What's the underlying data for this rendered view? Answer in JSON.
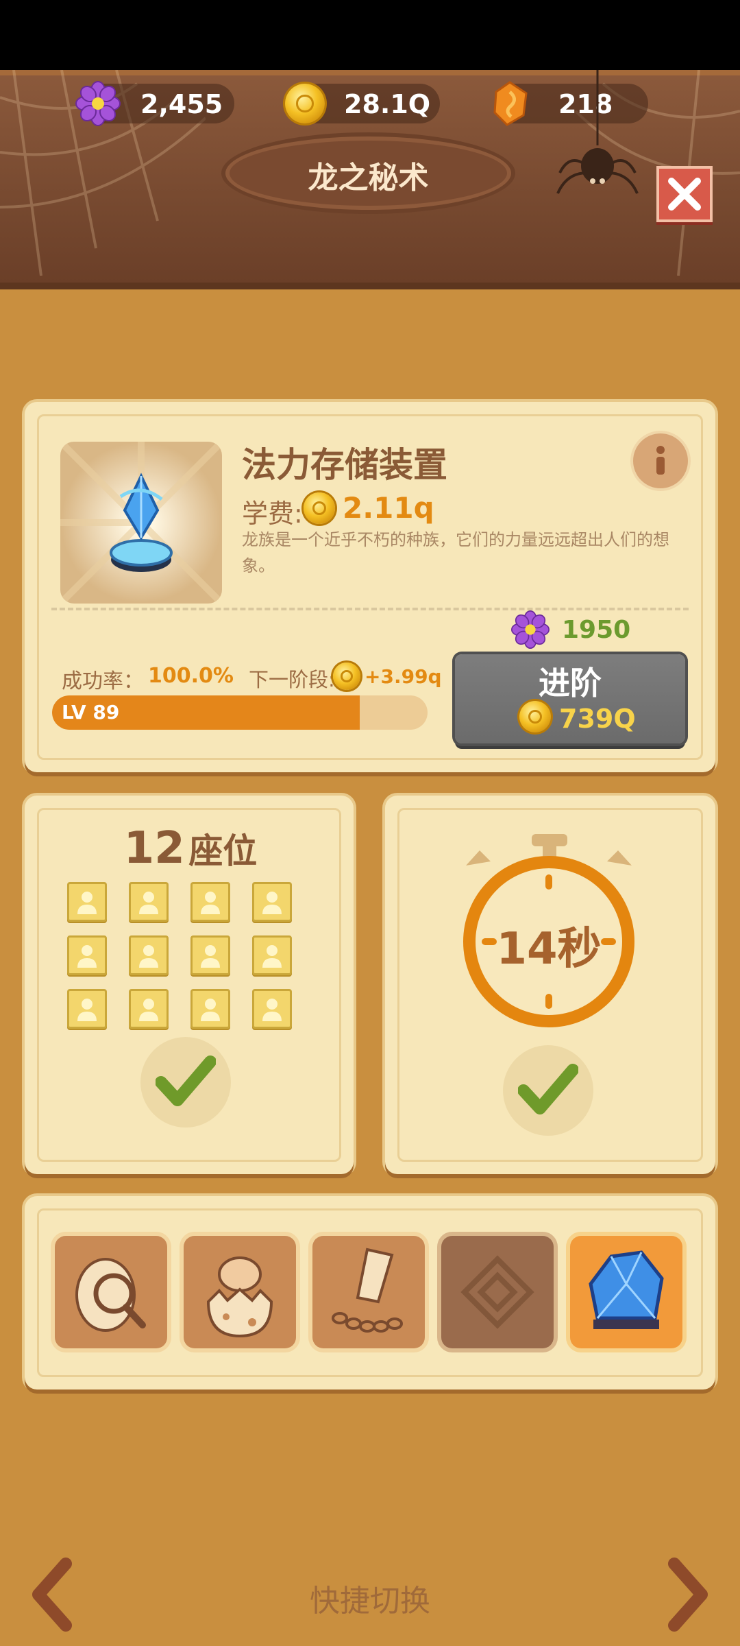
{
  "resources": [
    {
      "name": "flower",
      "value": "2,455",
      "icon": "purple-flower-icon"
    },
    {
      "name": "gold",
      "value": "28.1Q",
      "icon": "gold-coin-icon"
    },
    {
      "name": "gem",
      "value": "218",
      "icon": "orange-gem-icon"
    }
  ],
  "header": {
    "title": "龙之秘术",
    "close_icon": "close-icon"
  },
  "upgrade": {
    "item_name": "法力存储装置",
    "fee_label": "学费:",
    "fee_value": "2.11q",
    "description": "龙族是一个近乎不朽的种族，它们的力量远远超出人们的想象。",
    "success_label": "成功率：",
    "success_value": "100.0%",
    "next_stage_label": "下一阶段:",
    "next_stage_value": "+3.99q",
    "level_label": "LV 89",
    "level_progress": 0.82,
    "flower_cost": "1950",
    "advance_label": "进阶",
    "advance_cost": "739Q"
  },
  "seats": {
    "count": "12",
    "label": "座位",
    "total": 12
  },
  "timer": {
    "text": "14秒"
  },
  "skills": [
    "egg-search-icon",
    "hatchling-icon",
    "chained-claw-icon",
    "locked-spiral-icon",
    "blue-crystal-dragon-icon"
  ],
  "footer": {
    "label": "快捷切换"
  },
  "colors": {
    "accent": "#e4861a",
    "panel": "#f7e7b9",
    "header": "#7a4a30"
  }
}
